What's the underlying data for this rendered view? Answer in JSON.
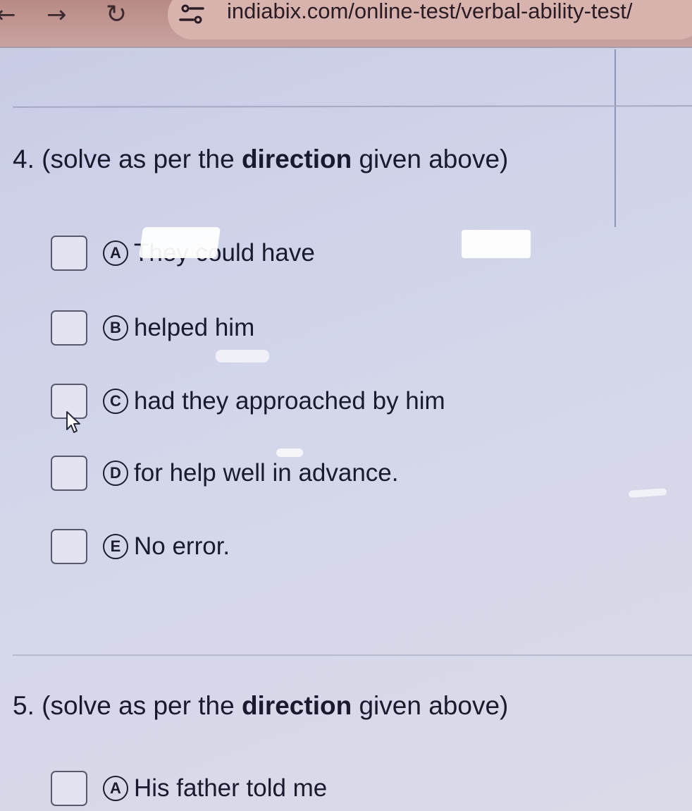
{
  "browser": {
    "back_icon": "back-arrow-icon",
    "forward_icon": "forward-arrow-icon",
    "reload_icon": "reload-icon",
    "site_info_icon": "site-settings-icon",
    "url": "indiabix.com/online-test/verbal-ability-test/"
  },
  "questions": [
    {
      "number": "4.",
      "prefix": "(solve as per the ",
      "emphasis": "direction",
      "suffix": " given above)",
      "options": [
        {
          "letter": "A",
          "text": "They could have"
        },
        {
          "letter": "B",
          "text": "helped him"
        },
        {
          "letter": "C",
          "text": "had they approached by him"
        },
        {
          "letter": "D",
          "text": "for help well in advance."
        },
        {
          "letter": "E",
          "text": "No error."
        }
      ]
    },
    {
      "number": "5.",
      "prefix": "(solve as per the ",
      "emphasis": "direction",
      "suffix": " given above)",
      "options": [
        {
          "letter": "A",
          "text": "His father told me"
        }
      ]
    }
  ]
}
